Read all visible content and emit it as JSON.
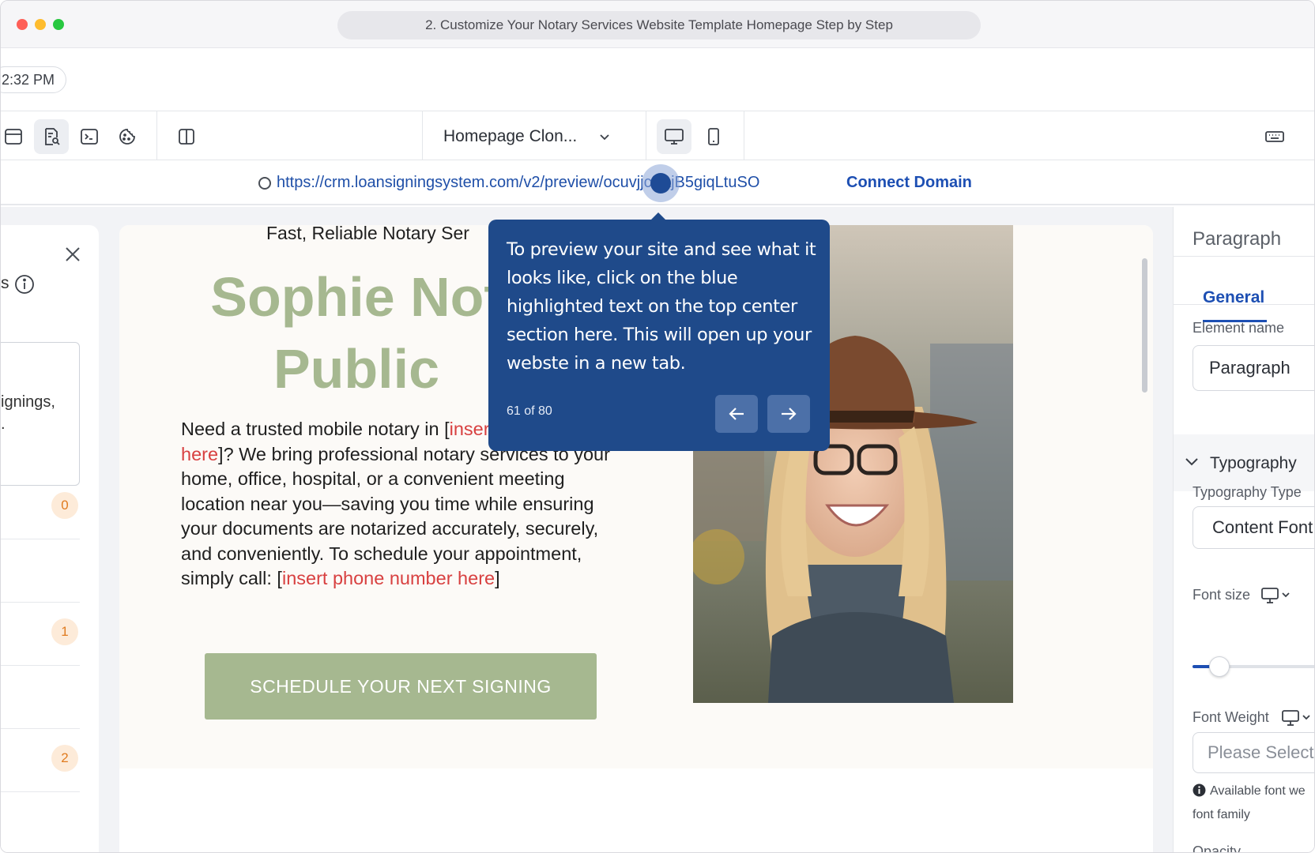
{
  "window": {
    "title": "2. Customize Your Notary Services Website Template Homepage Step by Step"
  },
  "header": {
    "time": "2:32 PM"
  },
  "toolbar": {
    "page_select": "Homepage Clon...",
    "icons": [
      "layout-icon",
      "seo-preview-icon",
      "code-icon",
      "cookie-icon",
      "split-view-icon",
      "desktop-icon",
      "mobile-icon",
      "keyboard-icon"
    ]
  },
  "urlbar": {
    "url": "https://crm.loansigningsystem.com/v2/preview/ocuvjjcEajB5giqLtuSO",
    "connect_label": "Connect Domain"
  },
  "left_panel": {
    "heading_fragment": "s",
    "box_text_line1": "ignings,",
    "box_text_line2": ".",
    "badges": [
      "0",
      "1",
      "2"
    ]
  },
  "site": {
    "tagline": "Fast, Reliable Notary Ser",
    "title_line1": "Sophie Not",
    "title_line2": "Public",
    "body_part1": "Need a trusted mobile notary in [",
    "body_ph1": "insert location(s) here",
    "body_part2": "]? We bring professional notary services to your home, office, hospital, or a convenient meeting location near you—saving you time while ensuring your documents are notarized accurately, securely, and conveniently. To schedule your appointment, simply call: [",
    "body_ph2": "insert phone number here",
    "body_part3": "]",
    "cta_label": "SCHEDULE YOUR NEXT SIGNING"
  },
  "right_panel": {
    "title": "Paragraph",
    "tab": "General",
    "element_name_label": "Element name",
    "element_name_value": "Paragraph",
    "typography_title": "Typography",
    "typography_type_label": "Typography Type",
    "typography_type_value": "Content Font",
    "font_size_label": "Font size",
    "font_size_fraction": 0.2,
    "font_weight_label": "Font Weight",
    "font_weight_placeholder": "Please Select",
    "note_line1": "Available font we",
    "note_line2": "font family",
    "opacity_label": "Opacity"
  },
  "tooltip": {
    "text": "To preview your site and see what it looks like, click on the blue highlighted text on the top center section here. This will open up your webste in a new tab.",
    "counter": "61 of 80"
  },
  "colors": {
    "accent": "#1d4fb3",
    "tooltip_bg": "#1f4a8a",
    "brand_green": "#a6b890",
    "placeholder_red": "#d84040"
  }
}
